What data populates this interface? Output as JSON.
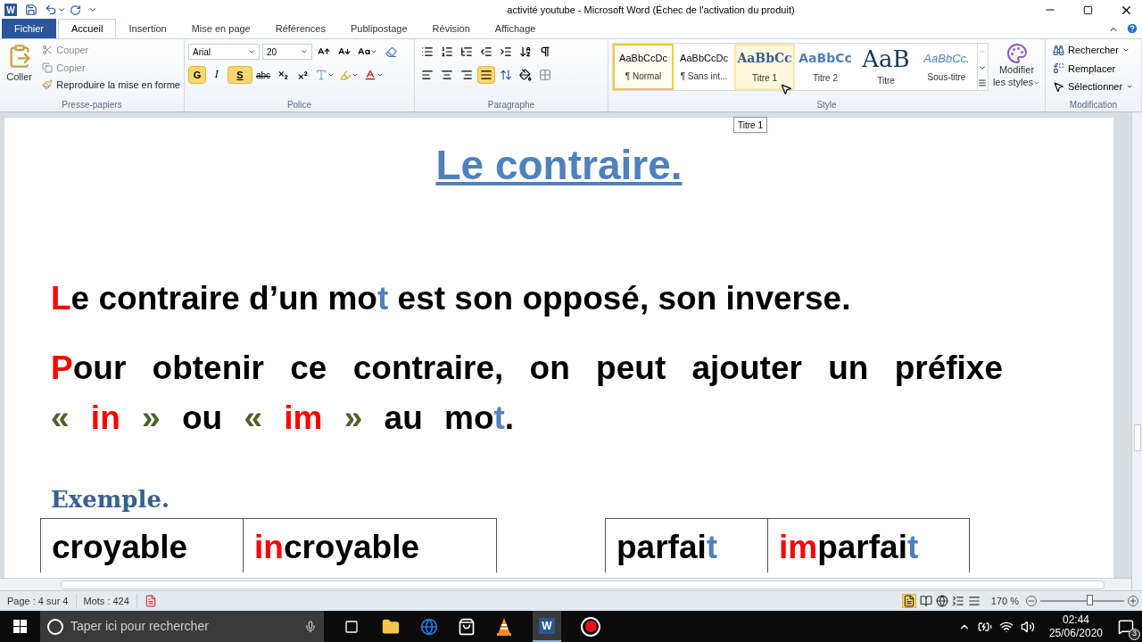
{
  "window": {
    "title": "activité youtube - Microsoft Word (Échec de l'activation du produit)",
    "app_icon": "W"
  },
  "tabs": [
    {
      "label": "Fichier",
      "kind": "file",
      "selected": false
    },
    {
      "label": "Accueil",
      "kind": "tab",
      "selected": true
    },
    {
      "label": "Insertion",
      "kind": "tab",
      "selected": false
    },
    {
      "label": "Mise en page",
      "kind": "tab",
      "selected": false
    },
    {
      "label": "Références",
      "kind": "tab",
      "selected": false
    },
    {
      "label": "Publipostage",
      "kind": "tab",
      "selected": false
    },
    {
      "label": "Révision",
      "kind": "tab",
      "selected": false
    },
    {
      "label": "Affichage",
      "kind": "tab",
      "selected": false
    }
  ],
  "clipboard": {
    "paste": "Coller",
    "cut": "Couper",
    "copy": "Copier",
    "format_painter": "Reproduire la mise en forme",
    "group": "Presse-papiers"
  },
  "font": {
    "name": "Arial",
    "size": "20",
    "bold": {
      "label": "G",
      "on": true
    },
    "italic": {
      "label": "I",
      "on": false
    },
    "underline": {
      "label": "S",
      "on": true
    },
    "strike": "abc",
    "group": "Police"
  },
  "paragraph": {
    "group": "Paragraphe",
    "justify_on": true
  },
  "styles": {
    "group": "Style",
    "items": [
      {
        "preview": "AaBbCcDc",
        "label": "¶ Normal",
        "kind": "normal",
        "selected": true,
        "hovered": false
      },
      {
        "preview": "AaBbCcDc",
        "label": "¶ Sans int...",
        "kind": "normal",
        "selected": false,
        "hovered": false
      },
      {
        "preview": "AaBbCc",
        "label": "Titre 1",
        "kind": "heading1",
        "selected": false,
        "hovered": true
      },
      {
        "preview": "AaBbCc",
        "label": "Titre 2",
        "kind": "heading2",
        "selected": false,
        "hovered": false
      },
      {
        "preview": "AaB",
        "label": "Titre",
        "kind": "title",
        "selected": false,
        "hovered": false
      },
      {
        "preview": "AaBbCc.",
        "label": "Sous-titre",
        "kind": "subtitle",
        "selected": false,
        "hovered": false
      }
    ],
    "modify": [
      "Modifier",
      "les styles"
    ]
  },
  "editing": {
    "group": "Modification",
    "find": "Rechercher",
    "replace": "Remplacer",
    "select": "Sélectionner"
  },
  "tooltip": "Titre 1",
  "document": {
    "heading": "Le contraire.",
    "paragraphs": [
      [
        {
          "text": "L",
          "color": "#ff0000"
        },
        {
          "text": "e contraire d’un mo",
          "color": "#000000"
        },
        {
          "text": "t",
          "color": "#4f81bd"
        },
        {
          "text": " est son opposé, son inverse.",
          "color": "#000000"
        }
      ],
      [
        {
          "text": "P",
          "color": "#ff0000"
        },
        {
          "text": "our obtenir ce contraire, on peut ajouter un préfixe ",
          "color": "#000000"
        },
        {
          "text": "« ",
          "color": "#4f6228"
        },
        {
          "text": "in",
          "color": "#ff0000"
        },
        {
          "text": " »",
          "color": "#4f6228"
        },
        {
          "text": " ou ",
          "color": "#000000"
        },
        {
          "text": "« ",
          "color": "#4f6228"
        },
        {
          "text": "im",
          "color": "#ff0000"
        },
        {
          "text": " »",
          "color": "#4f6228"
        },
        {
          "text": " au mo",
          "color": "#000000"
        },
        {
          "text": "t",
          "color": "#4f81bd"
        },
        {
          "text": ".",
          "color": "#000000"
        }
      ]
    ],
    "example": "Exemple.",
    "tables": [
      [
        [
          {
            "text": "croyable",
            "color": "#000000"
          }
        ],
        [
          {
            "text": "in",
            "color": "#ff0000"
          },
          {
            "text": "croyable",
            "color": "#000000"
          }
        ]
      ],
      [
        [
          {
            "text": "parfai",
            "color": "#000000"
          },
          {
            "text": "t",
            "color": "#4f81bd"
          }
        ],
        [
          {
            "text": "im",
            "color": "#ff0000"
          },
          {
            "text": "parfai",
            "color": "#000000"
          },
          {
            "text": "t",
            "color": "#4f81bd"
          }
        ]
      ]
    ]
  },
  "status_bar": {
    "page": "Page : 4 sur 4",
    "words": "Mots : 424",
    "zoom": "170 %",
    "zoom_slider": {
      "level": 0.58
    }
  },
  "taskbar": {
    "word_icon": "W",
    "search_placeholder": "Taper ici pour rechercher",
    "time": "02:44",
    "date": "25/06/2020",
    "notifications": "3"
  }
}
